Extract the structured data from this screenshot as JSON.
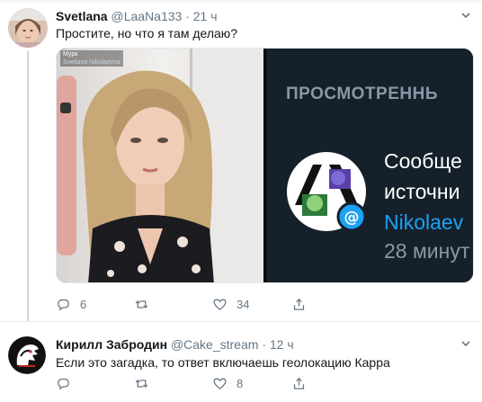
{
  "tweets": [
    {
      "name": "Svetlana",
      "handle": "@LaaNa133",
      "separator": "·",
      "time": "21 ч",
      "text": "Простите, но что я там делаю?",
      "media": {
        "left_caption_title": "Мурк",
        "left_caption_sub": "Svetlana Nikolaevna",
        "right_title": "ПРОСМОТРЕННЬ",
        "right_line1": "Сообще",
        "right_line2": "источни",
        "right_line3": "Nikolaev",
        "right_line4": "28 минут"
      },
      "actions": {
        "replies": "6",
        "retweets": "",
        "likes": "34"
      }
    },
    {
      "name": "Кирилл Забродин",
      "handle": "@Cake_stream",
      "separator": "·",
      "time": "12 ч",
      "text": "Если это загадка, то ответ включаешь геолокацию Карра",
      "actions": {
        "replies": "",
        "retweets": "",
        "likes": "8"
      }
    }
  ],
  "colors": {
    "link": "#1da1f2",
    "muted": "#657786",
    "text": "#14171a",
    "dark_bg": "#15202b"
  },
  "icons": [
    "reply-icon",
    "retweet-icon",
    "like-icon",
    "share-icon",
    "chevron-down-icon"
  ]
}
